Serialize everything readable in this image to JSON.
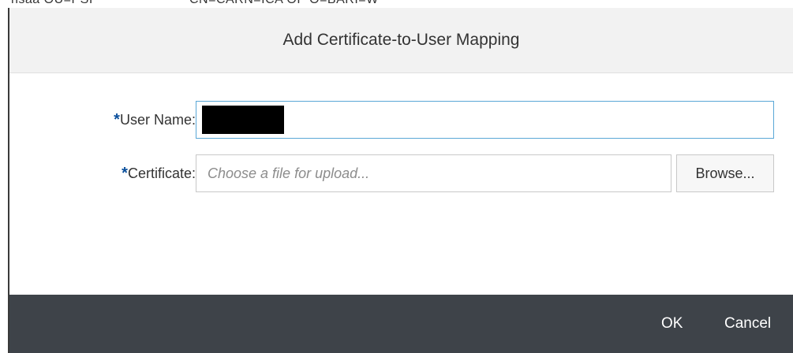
{
  "background": {
    "text_left": "nsaa OU=PSI",
    "text_right": "CN=CARN=ICA OP O=BARI=W"
  },
  "dialog": {
    "title": "Add Certificate-to-User Mapping",
    "fields": {
      "user_name": {
        "required_marker": "*",
        "label": "User Name:",
        "value": ""
      },
      "certificate": {
        "required_marker": "*",
        "label": "Certificate:",
        "placeholder": "Choose a file for upload...",
        "browse_label": "Browse..."
      }
    },
    "footer": {
      "ok_label": "OK",
      "cancel_label": "Cancel"
    }
  },
  "colors": {
    "footer_bg": "#3e4349",
    "header_bg": "#f2f2f2",
    "focus_border": "#5aa7d6",
    "required_star": "#0a4f9c"
  }
}
